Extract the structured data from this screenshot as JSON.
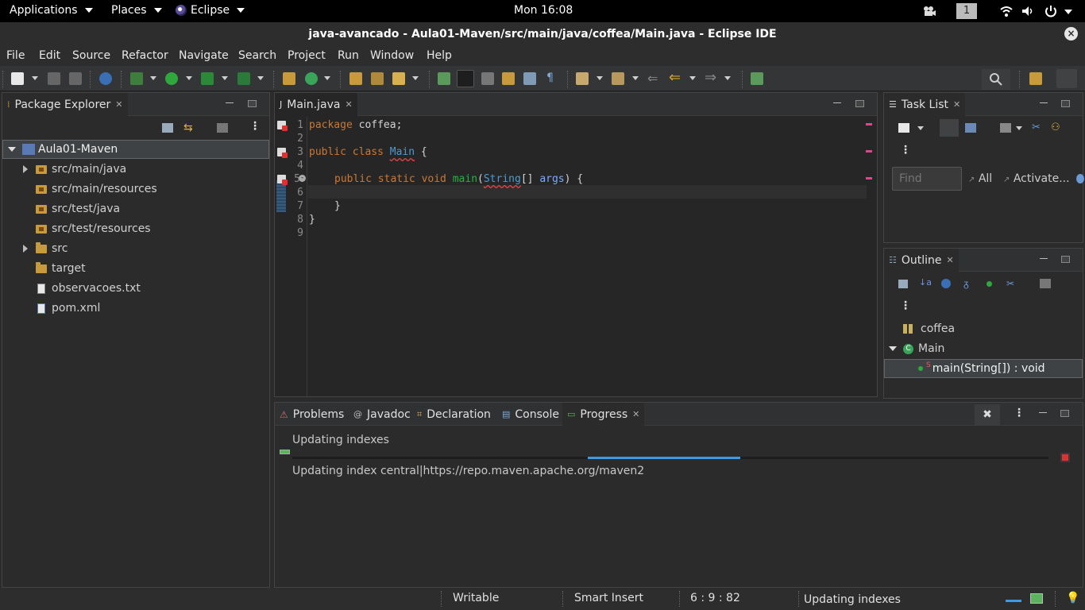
{
  "system_bar": {
    "applications": "Applications",
    "places": "Places",
    "app_name": "Eclipse",
    "clock": "Mon 16:08",
    "workspace_number": "1"
  },
  "window": {
    "title": "java-avancado - Aula01-Maven/src/main/java/coffea/Main.java - Eclipse IDE",
    "close_symbol": "×"
  },
  "menu": {
    "items": [
      "File",
      "Edit",
      "Source",
      "Refactor",
      "Navigate",
      "Search",
      "Project",
      "Run",
      "Window",
      "Help"
    ]
  },
  "package_explorer": {
    "tab_label": "Package Explorer",
    "project": "Aula01-Maven",
    "items": [
      {
        "label": "src/main/java",
        "icon": "package-folder-icon",
        "expandable": true
      },
      {
        "label": "src/main/resources",
        "icon": "package-folder-icon",
        "expandable": false
      },
      {
        "label": "src/test/java",
        "icon": "package-folder-icon",
        "expandable": false
      },
      {
        "label": "src/test/resources",
        "icon": "package-folder-icon",
        "expandable": false
      },
      {
        "label": "src",
        "icon": "folder-icon",
        "expandable": true
      },
      {
        "label": "target",
        "icon": "folder-icon",
        "expandable": false
      },
      {
        "label": "observacoes.txt",
        "icon": "text-file-icon",
        "expandable": false
      },
      {
        "label": "pom.xml",
        "icon": "xml-file-icon",
        "expandable": false
      }
    ]
  },
  "editor": {
    "tab_label": "Main.java",
    "line_numbers": [
      "1",
      "2",
      "3",
      "4",
      "5",
      "6",
      "7",
      "8",
      "9"
    ],
    "code": {
      "l1_kw": "package",
      "l1_rest": " coffea;",
      "l3_kw": "public class ",
      "l3_cls": "Main",
      "l3_rest": " {",
      "l5_kw": "public static void ",
      "l5_method": "main",
      "l5_open": "(",
      "l5_type": "String",
      "l5_arr": "[] ",
      "l5_param": "args",
      "l5_close": ") {",
      "l7": "}",
      "l8": "}"
    }
  },
  "task_list": {
    "tab_label": "Task List",
    "find_placeholder": "Find",
    "all_label": "All",
    "activate_label": "Activate..."
  },
  "outline": {
    "tab_label": "Outline",
    "package": "coffea",
    "class": "Main",
    "method": "main(String[]) : void"
  },
  "bottom_panel": {
    "tabs": [
      "Problems",
      "Javadoc",
      "Declaration",
      "Console",
      "Progress"
    ],
    "active_tab": "Progress",
    "job_title": "Updating indexes",
    "job_detail": "Updating index central|https://repo.maven.apache.org/maven2"
  },
  "status_bar": {
    "writable": "Writable",
    "insert_mode": "Smart Insert",
    "position": "6 : 9 : 82",
    "background_task": "Updating indexes"
  },
  "colors": {
    "accent_progress": "#3d9ae3",
    "error_red": "#e03030",
    "keyword": "#cc7832",
    "method": "#1eb540"
  }
}
